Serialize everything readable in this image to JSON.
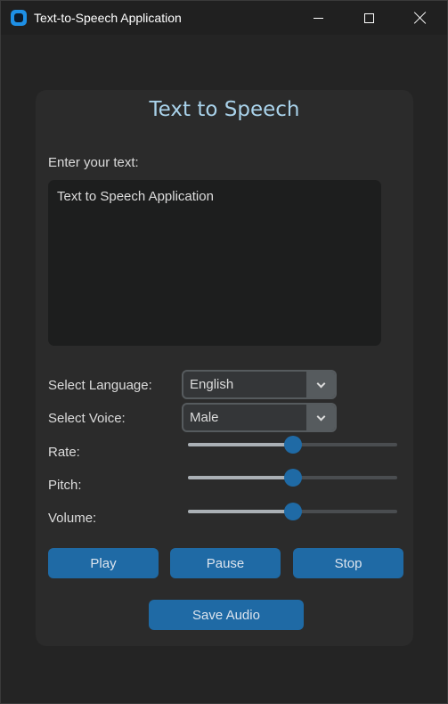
{
  "window": {
    "title": "Text-to-Speech Application"
  },
  "panel": {
    "heading": "Text to Speech",
    "text_label": "Enter your text:",
    "text_value": "Text to Speech Application"
  },
  "language": {
    "label": "Select Language:",
    "selected": "English"
  },
  "voice": {
    "label": "Select Voice:",
    "selected": "Male"
  },
  "sliders": {
    "rate": {
      "label": "Rate:",
      "value_fraction": 0.5
    },
    "pitch": {
      "label": "Pitch:",
      "value_fraction": 0.5
    },
    "volume": {
      "label": "Volume:",
      "value_fraction": 0.5
    }
  },
  "buttons": {
    "play": "Play",
    "pause": "Pause",
    "stop": "Stop",
    "save": "Save Audio"
  },
  "colors": {
    "accent": "#1f6aa5",
    "heading": "#a9d2ea"
  }
}
